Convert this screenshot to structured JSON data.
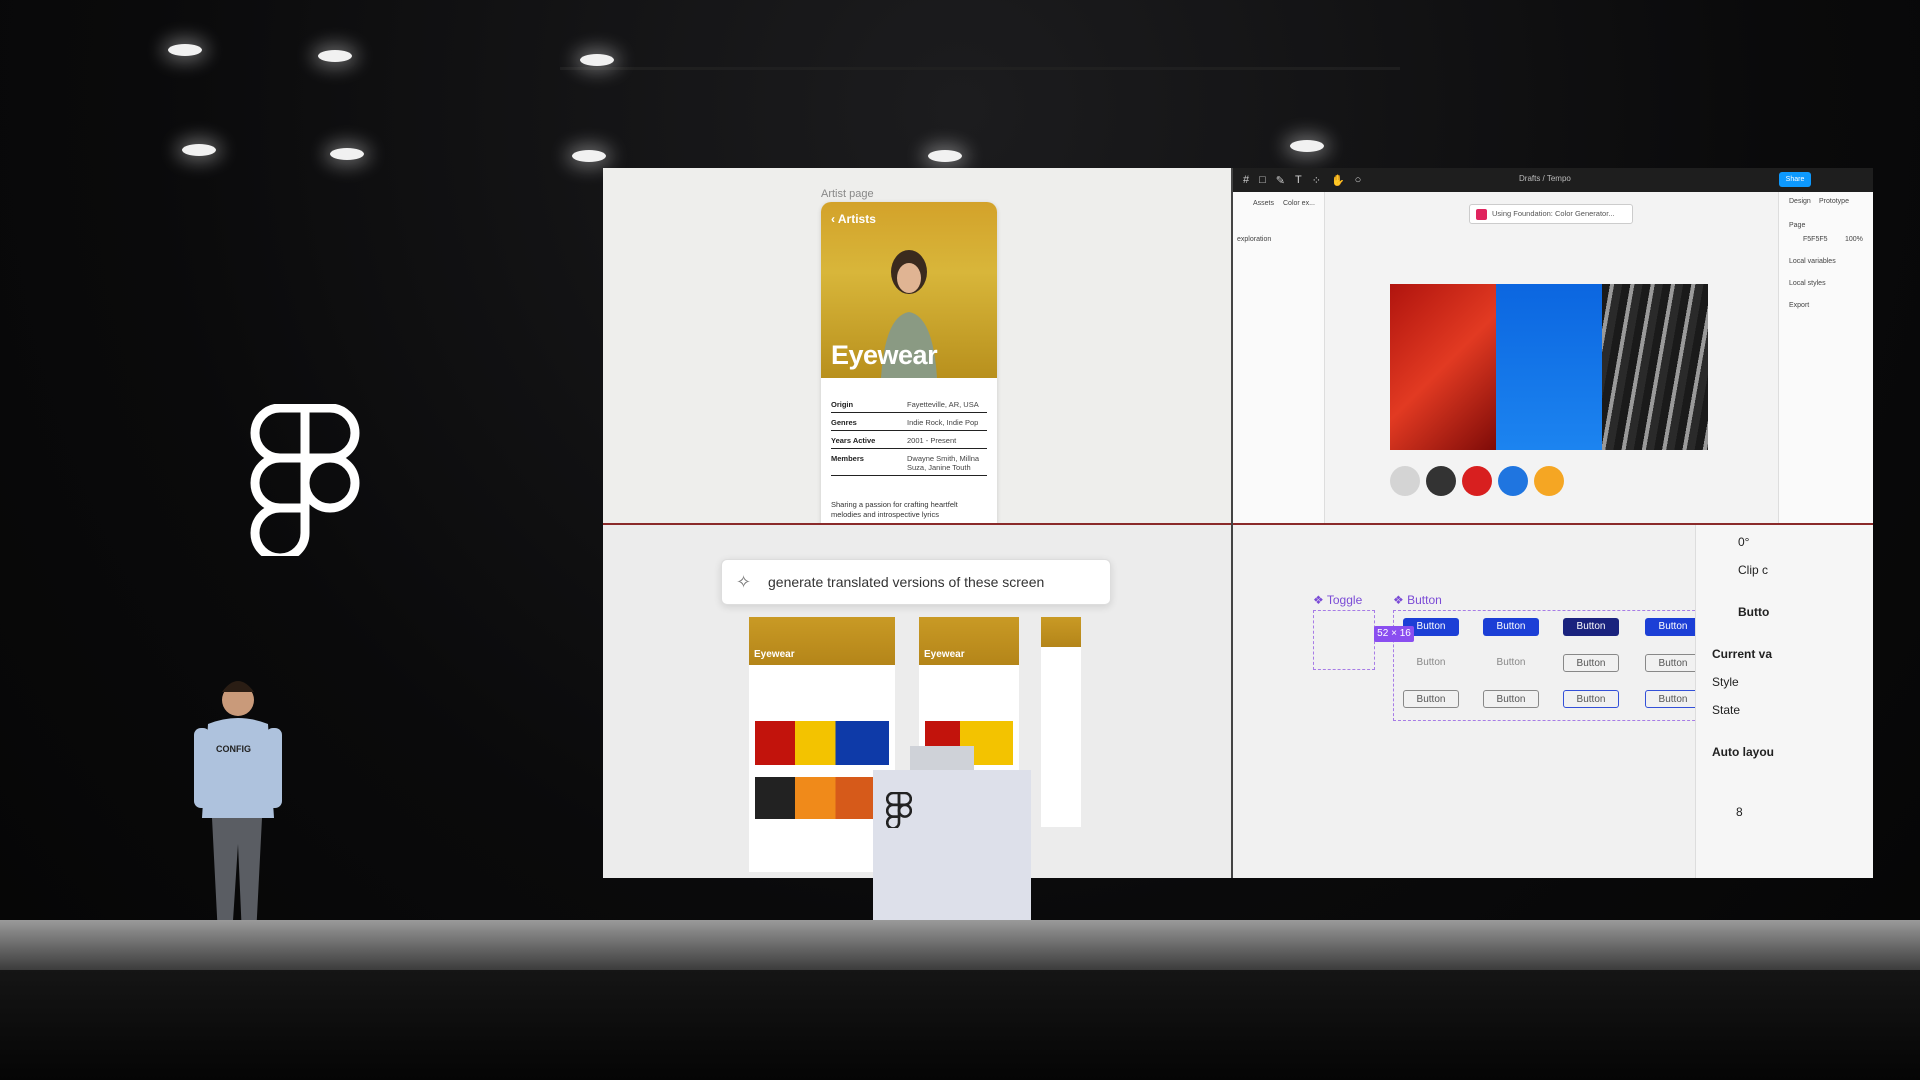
{
  "stage": {
    "brand_logo": "figma-logo",
    "presenter_shirt": "CONFIG"
  },
  "artist_page": {
    "label": "Artist page",
    "back_label": "Artists",
    "title": "Eyewear",
    "rows": [
      {
        "key": "Origin",
        "value": "Fayetteville, AR, USA"
      },
      {
        "key": "Genres",
        "value": "Indie Rock, Indie Pop"
      },
      {
        "key": "Years Active",
        "value": "2001 - Present"
      },
      {
        "key": "Members",
        "value": "Dwayne Smith, Millna Suza, Janine Touth"
      }
    ],
    "bio": "Sharing a passion for crafting heartfelt melodies and introspective lyrics"
  },
  "editor": {
    "breadcrumb": "Drafts / Tempo",
    "share_label": "Share",
    "left_tabs": [
      "Assets",
      "Color ex..."
    ],
    "left_item": "exploration",
    "right_tabs": [
      "Design",
      "Prototype"
    ],
    "right_page_label": "Page",
    "right_page_color": "F5F5F5",
    "right_page_opacity": "100%",
    "right_sections": [
      "Local variables",
      "Local styles",
      "Export"
    ],
    "plugin_toast": "Using Foundation: Color Generator...",
    "swatches": [
      "#d4d4d4",
      "#333333",
      "#d81f1f",
      "#1f75e0",
      "#f5a623"
    ]
  },
  "prompt": {
    "text": "generate translated versions of these screen"
  },
  "minis": {
    "title": "Eyewear"
  },
  "components": {
    "toggle_label": "Toggle",
    "button_label": "Button",
    "button_text": "Button",
    "size_badge": "52 × 16",
    "props": {
      "angle": "0°",
      "clip": "Clip c",
      "instance": "Butto",
      "current": "Current va",
      "style": "Style",
      "state": "State",
      "auto_layout": "Auto layou",
      "gap": "8"
    }
  }
}
